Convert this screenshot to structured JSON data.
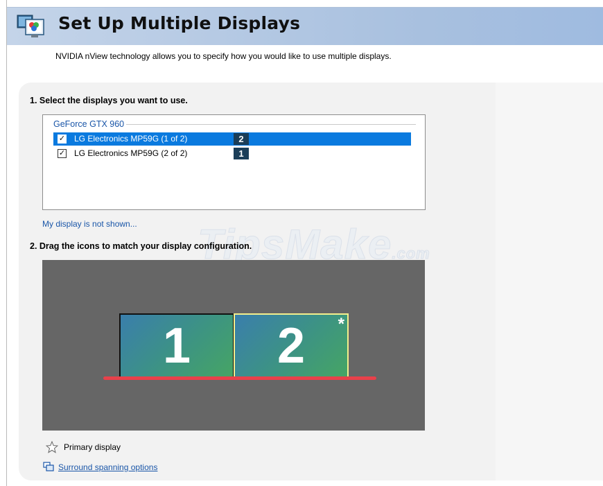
{
  "header": {
    "title": "Set Up Multiple Displays",
    "icon": "nvidia-display-icon"
  },
  "intro": "NVIDIA nView technology allows you to specify how you would like to use multiple displays.",
  "step1": {
    "label": "1. Select the displays you want to use.",
    "group": "GeForce GTX 960",
    "displays": [
      {
        "label": "LG Electronics MP59G (1 of 2)",
        "badge": "2",
        "checked": true,
        "selected": true
      },
      {
        "label": "LG Electronics MP59G (2 of 2)",
        "badge": "1",
        "checked": true,
        "selected": false
      }
    ],
    "link": "My display is not shown..."
  },
  "step2": {
    "label": "2. Drag the icons to match your display configuration.",
    "monitors": [
      {
        "number": "1",
        "primary": false
      },
      {
        "number": "2",
        "primary": true,
        "marker": "*"
      }
    ]
  },
  "legend": {
    "primary_label": "Primary display",
    "icon": "primary-star-icon"
  },
  "surround_link": "Surround spanning options",
  "watermark": {
    "main": "TipsMake",
    "suffix": ".com"
  },
  "colors": {
    "header_gradient": "#a8c0df",
    "selection": "#0a7adf",
    "badge": "#1b3e58",
    "canvas": "#666666",
    "primary_border": "#f4ef8c",
    "floor_line": "#e8414a",
    "link": "#1a56a8"
  }
}
